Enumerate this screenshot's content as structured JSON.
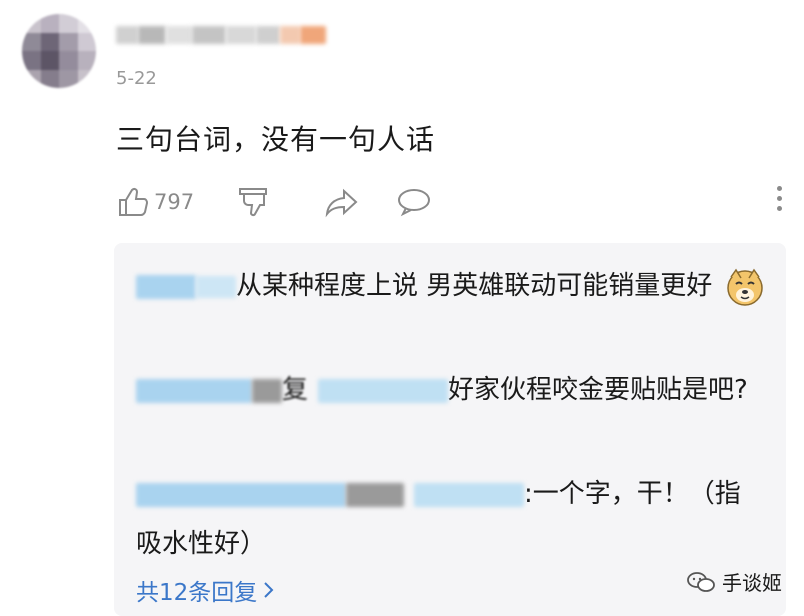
{
  "comment": {
    "date": "5-22",
    "text": "三句台词，没有一句人话",
    "like_count": "797",
    "icons": [
      "thumb-up-icon",
      "thumb-down-icon",
      "share-icon",
      "reply-bubble-icon",
      "more-vertical-icon"
    ]
  },
  "replies": [
    {
      "text": "从某种程度上说 男英雄联动可能销量更好",
      "emoji": "doge-emoji"
    },
    {
      "mid_char": "复",
      "text": "好家伙程咬金要贴贴是吧?"
    },
    {
      "text": ":一个字，干！（指吸水性好）"
    }
  ],
  "more_replies": "共12条回复",
  "watermark": "手谈姬",
  "colors": {
    "link": "#3b77c9",
    "muted": "#8a8a8a",
    "reply_bg": "#f5f5f7"
  }
}
